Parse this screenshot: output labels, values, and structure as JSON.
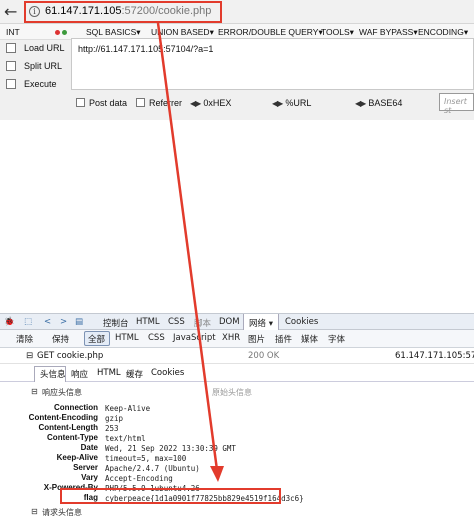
{
  "browser": {
    "url_host": "61.147.171.105",
    "url_rest": ":57200/cookie.php"
  },
  "hackbar": {
    "menu": [
      "INT",
      "SQL BASICS",
      "UNION BASED",
      "ERROR/DOUBLE QUERY",
      "TOOLS",
      "WAF BYPASS",
      "ENCODING"
    ],
    "actions": [
      "Load URL",
      "Split URL",
      "Execute"
    ],
    "url_value": "http://61.147.171.105:57104/?a=1",
    "options": [
      "Post data",
      "Referrer",
      "0xHEX",
      "%URL",
      "BASE64"
    ],
    "insert_placeholder": "Insert st"
  },
  "devtools": {
    "top_tabs": [
      "控制台",
      "HTML",
      "CSS",
      "脚本",
      "DOM",
      "网络",
      "Cookies"
    ],
    "filter_tabs": [
      "清除",
      "保持",
      "全部",
      "HTML",
      "CSS",
      "JavaScript",
      "XHR",
      "图片",
      "插件",
      "媒体",
      "字体"
    ],
    "request": {
      "label": "GET cookie.php",
      "status": "200 OK",
      "host": "61.147.171.105:57200"
    },
    "detail_tabs": [
      "头信息",
      "响应",
      "HTML",
      "缓存",
      "Cookies"
    ],
    "response_section": "响应头信息",
    "raw_link": "原始头信息",
    "headers": [
      {
        "k": "Connection",
        "v": "Keep-Alive"
      },
      {
        "k": "Content-Encoding",
        "v": "gzip"
      },
      {
        "k": "Content-Length",
        "v": "253"
      },
      {
        "k": "Content-Type",
        "v": "text/html"
      },
      {
        "k": "Date",
        "v": "Wed, 21 Sep 2022 13:30:39 GMT"
      },
      {
        "k": "Keep-Alive",
        "v": "timeout=5, max=100"
      },
      {
        "k": "Server",
        "v": "Apache/2.4.7 (Ubuntu)"
      },
      {
        "k": "Vary",
        "v": "Accept-Encoding"
      },
      {
        "k": "X-Powered-By",
        "v": "PHP/5.5.9-1ubuntu4.26"
      },
      {
        "k": "flag",
        "v": "cyberpeace{1d1a0901f77825bb829e4519f164d3c6}"
      }
    ],
    "request_section": "请求头信息"
  },
  "colors": {
    "highlight": "#e23b2c"
  }
}
